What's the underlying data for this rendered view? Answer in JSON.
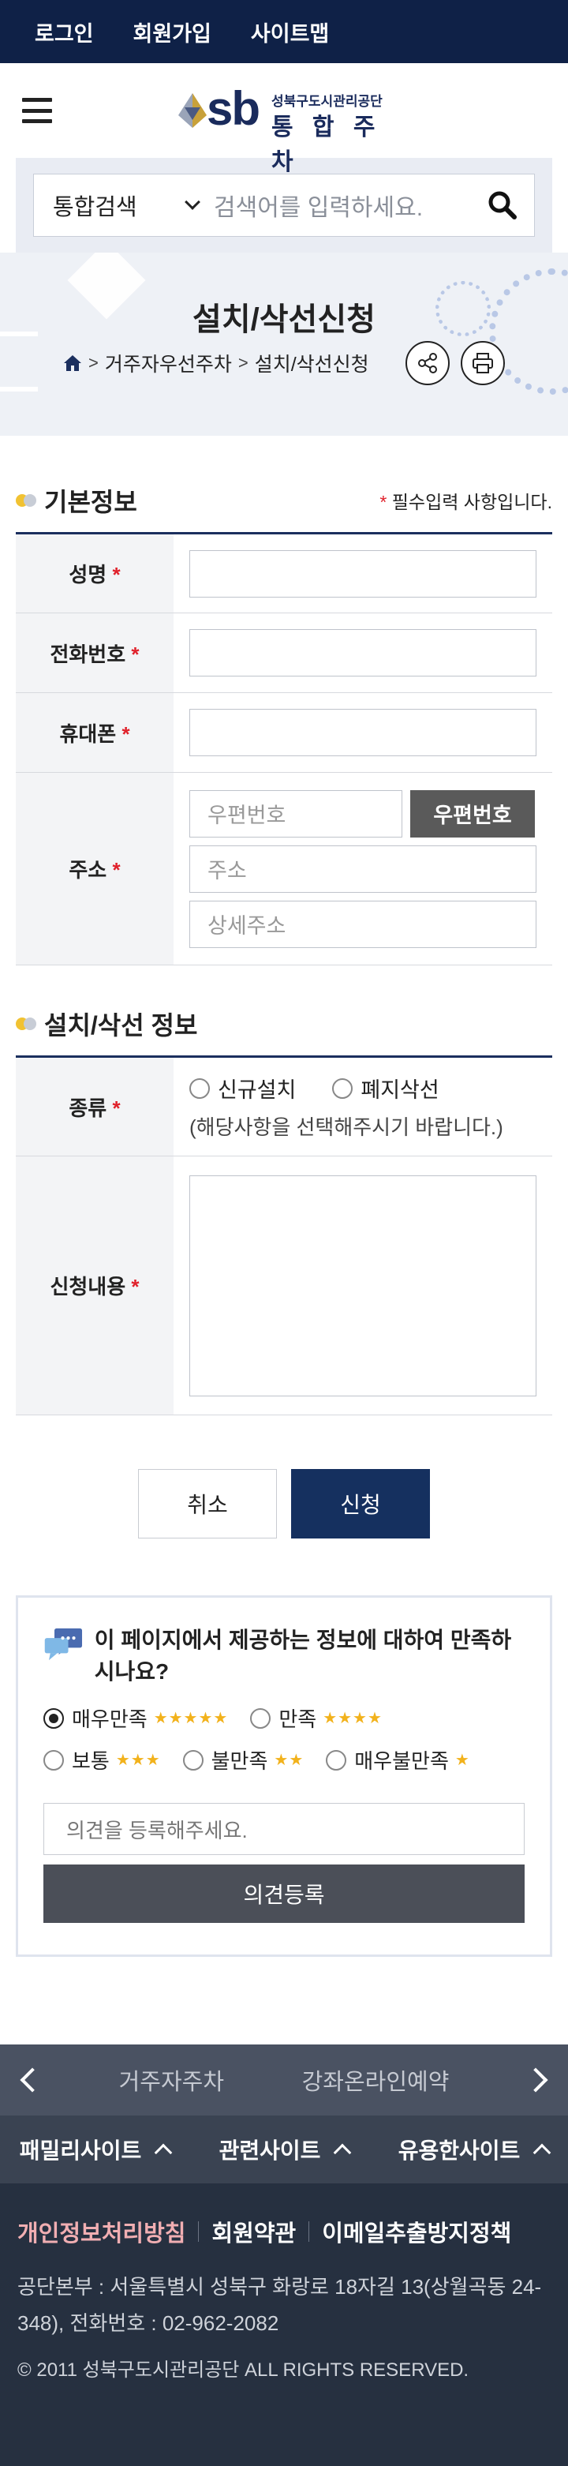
{
  "topbar": {
    "login": "로그인",
    "join": "회원가입",
    "sitemap": "사이트맵"
  },
  "header": {
    "logo_small": "성북구도시관리공단",
    "logo_big": "통 합 주 차",
    "logo_sb": "sb"
  },
  "search": {
    "select_value": "통합검색",
    "placeholder": "검색어를 입력하세요."
  },
  "page": {
    "title": "설치/삭선신청",
    "breadcrumb": [
      "거주자우선주차",
      "설치/삭선신청"
    ]
  },
  "basic_info": {
    "title": "기본정보",
    "required_note": "필수입력 사항입니다.",
    "name_label": "성명",
    "phone_label": "전화번호",
    "mobile_label": "휴대폰",
    "address_label": "주소",
    "zip_placeholder": "우편번호",
    "zip_button": "우편번호",
    "addr_placeholder": "주소",
    "addr_detail_placeholder": "상세주소"
  },
  "install_info": {
    "title": "설치/삭선 정보",
    "type_label": "종류",
    "option_new": "신규설치",
    "option_remove": "폐지삭선",
    "type_hint": "(해당사항을 선택해주시기 바랍니다.)",
    "content_label": "신청내용"
  },
  "actions": {
    "cancel": "취소",
    "submit": "신청"
  },
  "survey": {
    "question": "이 페이지에서 제공하는 정보에 대하여 만족하시나요?",
    "options": [
      {
        "label": "매우만족",
        "stars": "★★★★★",
        "selected": true
      },
      {
        "label": "만족",
        "stars": "★★★★",
        "selected": false
      },
      {
        "label": "보통",
        "stars": "★★★",
        "selected": false
      },
      {
        "label": "불만족",
        "stars": "★★",
        "selected": false
      },
      {
        "label": "매우불만족",
        "stars": "★",
        "selected": false
      }
    ],
    "opinion_placeholder": "의견을 등록해주세요.",
    "register_button": "의견등록"
  },
  "footer": {
    "banner": [
      "거주자주차",
      "강좌온라인예약"
    ],
    "family": [
      "패밀리사이트",
      "관련사이트",
      "유용한사이트"
    ],
    "links": [
      "개인정보처리방침",
      "회원약관",
      "이메일추출방지정책"
    ],
    "address": "공단본부 : 서울특별시 성북구 화랑로 18자길 13(상월곡동 24-348), 전화번호 : 02-962-2082",
    "copyright": "© 2011 성북구도시관리공단 ALL RIGHTS RESERVED."
  },
  "colors": {
    "topbar": "#0f2147",
    "primary": "#15305f",
    "required": "#e0212b",
    "footer": "#263040",
    "star": "#f2b21c"
  }
}
